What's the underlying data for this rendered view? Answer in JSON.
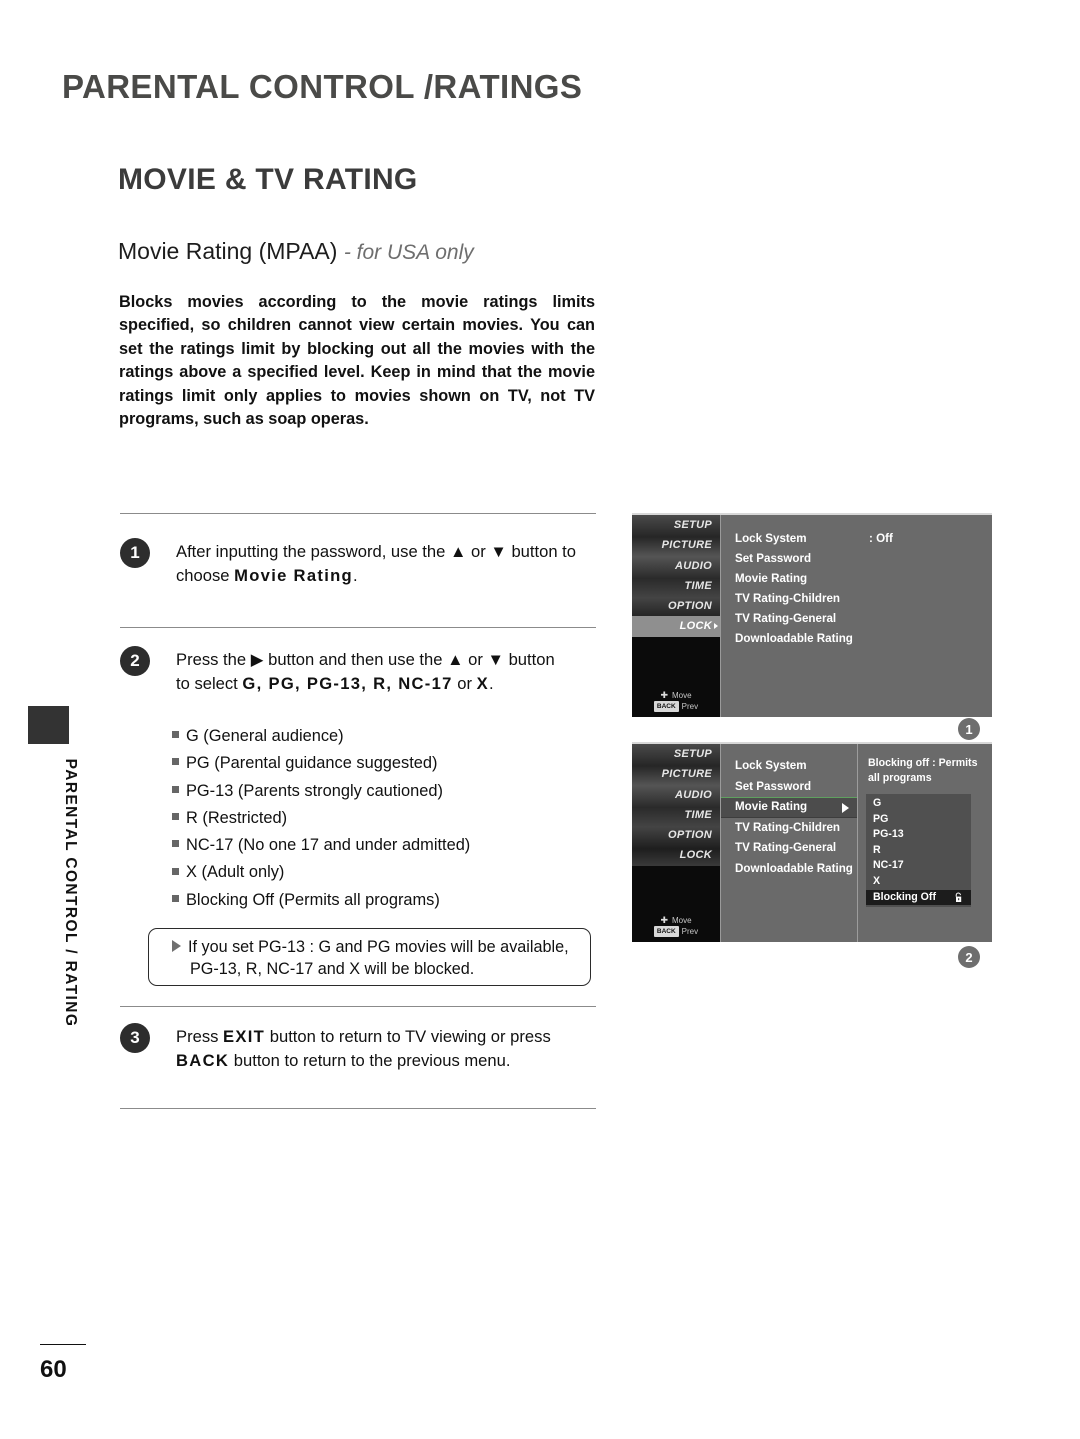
{
  "page": {
    "chapter_title": "PARENTAL CONTROL /RATINGS",
    "section_title": "MOVIE & TV RATING",
    "subsection_title": "Movie Rating (MPAA)",
    "subsection_note": "- for USA only",
    "side_tab_label": "PARENTAL CONTROL / RATING",
    "page_number": "60",
    "intro": "Blocks movies according to the movie ratings limits specified, so children cannot view certain movies. You can set the ratings limit by blocking out all the movies with the ratings above a specified level. Keep in mind that the movie ratings limit only applies to movies shown on TV, not TV programs, such as soap operas."
  },
  "steps": [
    {
      "number": "1",
      "line1_pre": "After inputting the password, use the ",
      "up_arrow": "▲",
      "line1_mid": " or ",
      "down_arrow": "▼",
      "line1_post": " button to",
      "line2_pre": "choose ",
      "line2_bold": "Movie Rating",
      "line2_post": "."
    },
    {
      "number": "2",
      "line1_pre": "Press the ",
      "right_arrow": "▶",
      "line1_mid": " button and then use the  ",
      "up_arrow": "▲",
      "line1_mid2": " or ",
      "down_arrow": "▼",
      "line1_post": " button",
      "line2_pre": "to select ",
      "line2_bold": "G, PG, PG-13, R, NC-17",
      "line2_mid": " or ",
      "line2_bold2": "X",
      "line2_post": "."
    },
    {
      "number": "3",
      "line1_pre": "Press ",
      "key1": "EXIT",
      "line1_mid": " button to return to TV viewing or press",
      "key2": "BACK",
      "line2_post": " button to return to the previous menu."
    }
  ],
  "rating_list": [
    "G (General audience)",
    "PG (Parental guidance suggested)",
    "PG-13 (Parents strongly cautioned)",
    "R (Restricted)",
    "NC-17 (No one 17 and under admitted)",
    "X (Adult only)",
    "Blocking Off (Permits all programs)"
  ],
  "note": {
    "line1": "If you set PG-13 : G and PG movies will be available,",
    "line2": "PG-13, R, NC-17 and X will be blocked."
  },
  "osd": {
    "categories": [
      "SETUP",
      "PICTURE",
      "AUDIO",
      "TIME",
      "OPTION",
      "LOCK"
    ],
    "hints": {
      "move": "Move",
      "back_key": "BACK",
      "prev": "Prev"
    },
    "panel1": {
      "badge": "1",
      "items": [
        {
          "label": "Lock System",
          "value": ": Off"
        },
        {
          "label": "Set Password",
          "value": ""
        },
        {
          "label": "Movie Rating",
          "value": ""
        },
        {
          "label": "TV Rating-Children",
          "value": ""
        },
        {
          "label": "TV Rating-General",
          "value": ""
        },
        {
          "label": "Downloadable Rating",
          "value": ""
        }
      ],
      "selected_category": "LOCK"
    },
    "panel2": {
      "badge": "2",
      "items": [
        {
          "label": "Lock System"
        },
        {
          "label": "Set Password"
        },
        {
          "label": "Movie Rating"
        },
        {
          "label": "TV Rating-Children"
        },
        {
          "label": "TV Rating-General"
        },
        {
          "label": "Downloadable Rating"
        }
      ],
      "highlighted_item": "Movie Rating",
      "description": "Blocking off : Permits all programs",
      "options": [
        "G",
        "PG",
        "PG-13",
        "R",
        "NC-17",
        "X",
        "Blocking Off"
      ],
      "selected_option": "Blocking Off"
    }
  },
  "colors": {
    "osd_background": "#6a6a6a",
    "osd_selected": "#1c1c1c",
    "osd_highlight_border": "#5fa05f",
    "heading": "#4a4a48",
    "rule": "#8b8b8b"
  }
}
